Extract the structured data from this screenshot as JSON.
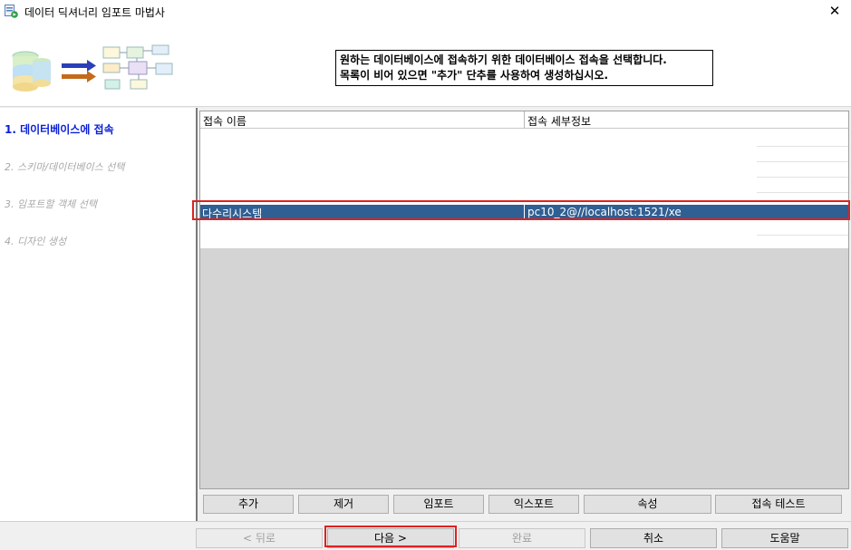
{
  "window": {
    "title": "데이터 딕셔너리 임포트 마법사",
    "close_glyph": "✕"
  },
  "header": {
    "instruction_line1": "원하는 데이터베이스에 접속하기 위한 데이터베이스 접속을 선택합니다.",
    "instruction_line2": "목록이 비어 있으면 \"추가\" 단추를 사용하여 생성하십시오."
  },
  "steps": [
    {
      "label": "1. 데이터베이스에 접속",
      "active": true
    },
    {
      "label": "2. 스키마/데이터베이스 선택",
      "active": false
    },
    {
      "label": "3. 임포트할 객체 선택",
      "active": false
    },
    {
      "label": "4. 디자인 생성",
      "active": false
    }
  ],
  "table": {
    "columns": [
      "접속 이름",
      "접속 세부정보"
    ],
    "rows": [
      {
        "name": "다수리시스템",
        "details": "pc10_2@//localhost:1521/xe",
        "selected": true
      }
    ]
  },
  "actions": {
    "add": "추가",
    "remove": "제거",
    "import": "임포트",
    "export": "익스포트",
    "properties": "속성",
    "test_connection": "접속 테스트"
  },
  "nav": {
    "back": "< 뒤로",
    "next": "다음 >",
    "finish": "완료",
    "cancel": "취소",
    "help": "도움말"
  },
  "colors": {
    "selection": "#2f5f93",
    "active_step": "#0a1fd6",
    "highlight_outline": "#dd2222"
  }
}
